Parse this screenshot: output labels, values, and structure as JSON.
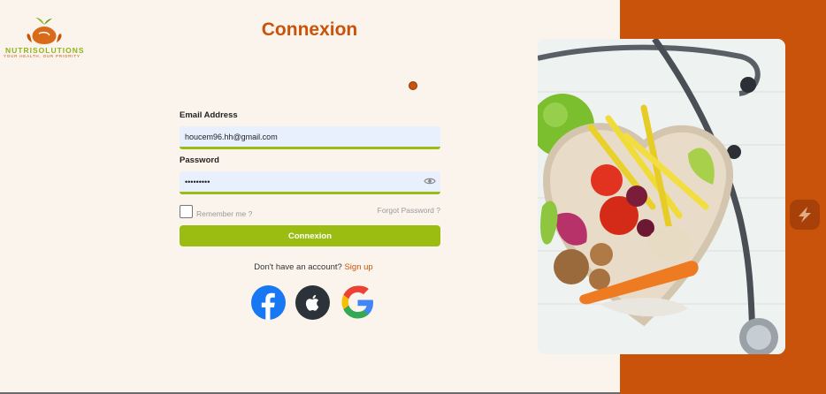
{
  "logo": {
    "name": "NUTRISOLUTIONS",
    "tagline": "YOUR HEALTH, OUR PRIORITY"
  },
  "title": "Connexion",
  "email": {
    "label": "Email Address",
    "value": "houcem96.hh@gmail.com"
  },
  "password": {
    "label": "Password",
    "value": "passwords"
  },
  "remember_label": "Remember me ?",
  "forgot_label": "Forgot Password ?",
  "submit_label": "Connexion",
  "signup": {
    "prompt": "Don't have an account?",
    "link": "Sign up"
  },
  "icons": {
    "facebook": "facebook-icon",
    "apple": "apple-icon",
    "google": "google-icon",
    "eye": "eye-icon",
    "side_widget": "lightning-icon"
  },
  "colors": {
    "brand_orange": "#c9530a",
    "brand_green": "#9bbd12",
    "background": "#fbf4ec",
    "input_bg": "#e8f0fe"
  }
}
